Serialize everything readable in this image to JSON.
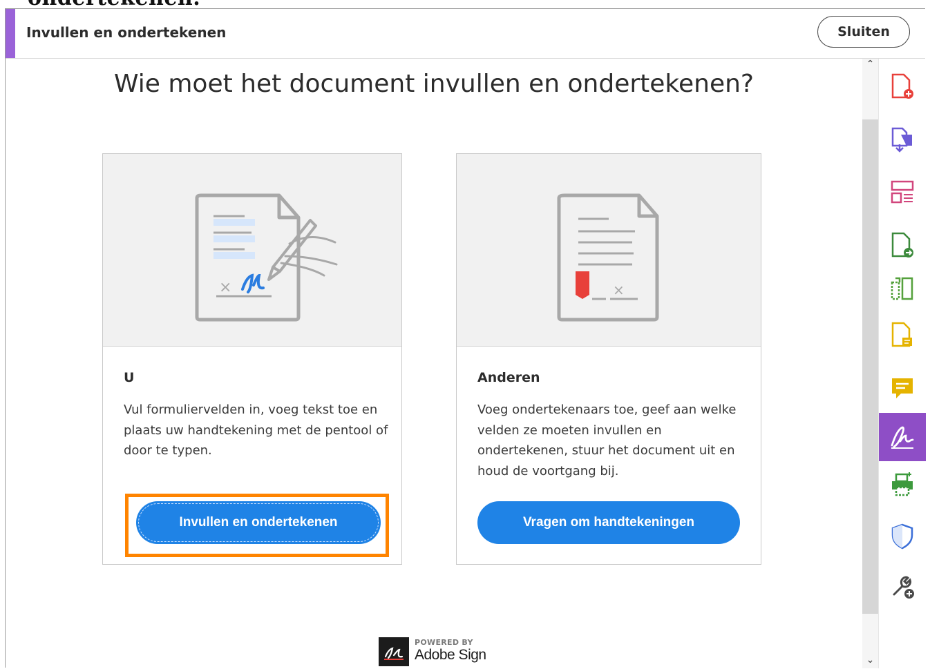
{
  "page_caption": "ondertekenen.",
  "header": {
    "title": "Invullen en ondertekenen",
    "close_label": "Sluiten"
  },
  "main": {
    "heading": "Wie moet het document invullen en ondertekenen?"
  },
  "cards": [
    {
      "title": "U",
      "text": "Vul formuliervelden in, voeg tekst toe en plaats uw handtekening met de pentool of door te typen.",
      "button_label": "Invullen en ondertekenen"
    },
    {
      "title": "Anderen",
      "text": "Voeg ondertekenaars toe, geef aan welke velden ze moeten invullen en ondertekenen, stuur het document uit en houd de voortgang bij.",
      "button_label": "Vragen om handtekeningen"
    }
  ],
  "powered_by": {
    "label": "POWERED BY",
    "brand": "Adobe Sign"
  },
  "sidebar_tools": [
    {
      "icon": "create-pdf-icon",
      "color": "#e8403a"
    },
    {
      "icon": "export-pdf-icon",
      "color": "#6b5bd6"
    },
    {
      "icon": "edit-pdf-icon",
      "color": "#d1457c"
    },
    {
      "icon": "send-pdf-icon",
      "color": "#3c8a3c"
    },
    {
      "icon": "organize-pages-icon",
      "color": "#55a13c"
    },
    {
      "icon": "send-for-comments-icon",
      "color": "#e5b300"
    },
    {
      "icon": "comment-icon",
      "color": "#e5b300"
    },
    {
      "icon": "fill-sign-icon",
      "color": "#ffffff",
      "active": true
    },
    {
      "icon": "print-production-icon",
      "color": "#3c9a3c"
    },
    {
      "icon": "protect-icon",
      "color": "#3b6fd8"
    },
    {
      "icon": "more-tools-icon",
      "color": "#4a4a4a"
    }
  ],
  "colors": {
    "accent": "#9a63d8",
    "primary_button": "#1f83e6",
    "focus_ring": "#ff8400",
    "active_tool": "#8e4ec6"
  }
}
